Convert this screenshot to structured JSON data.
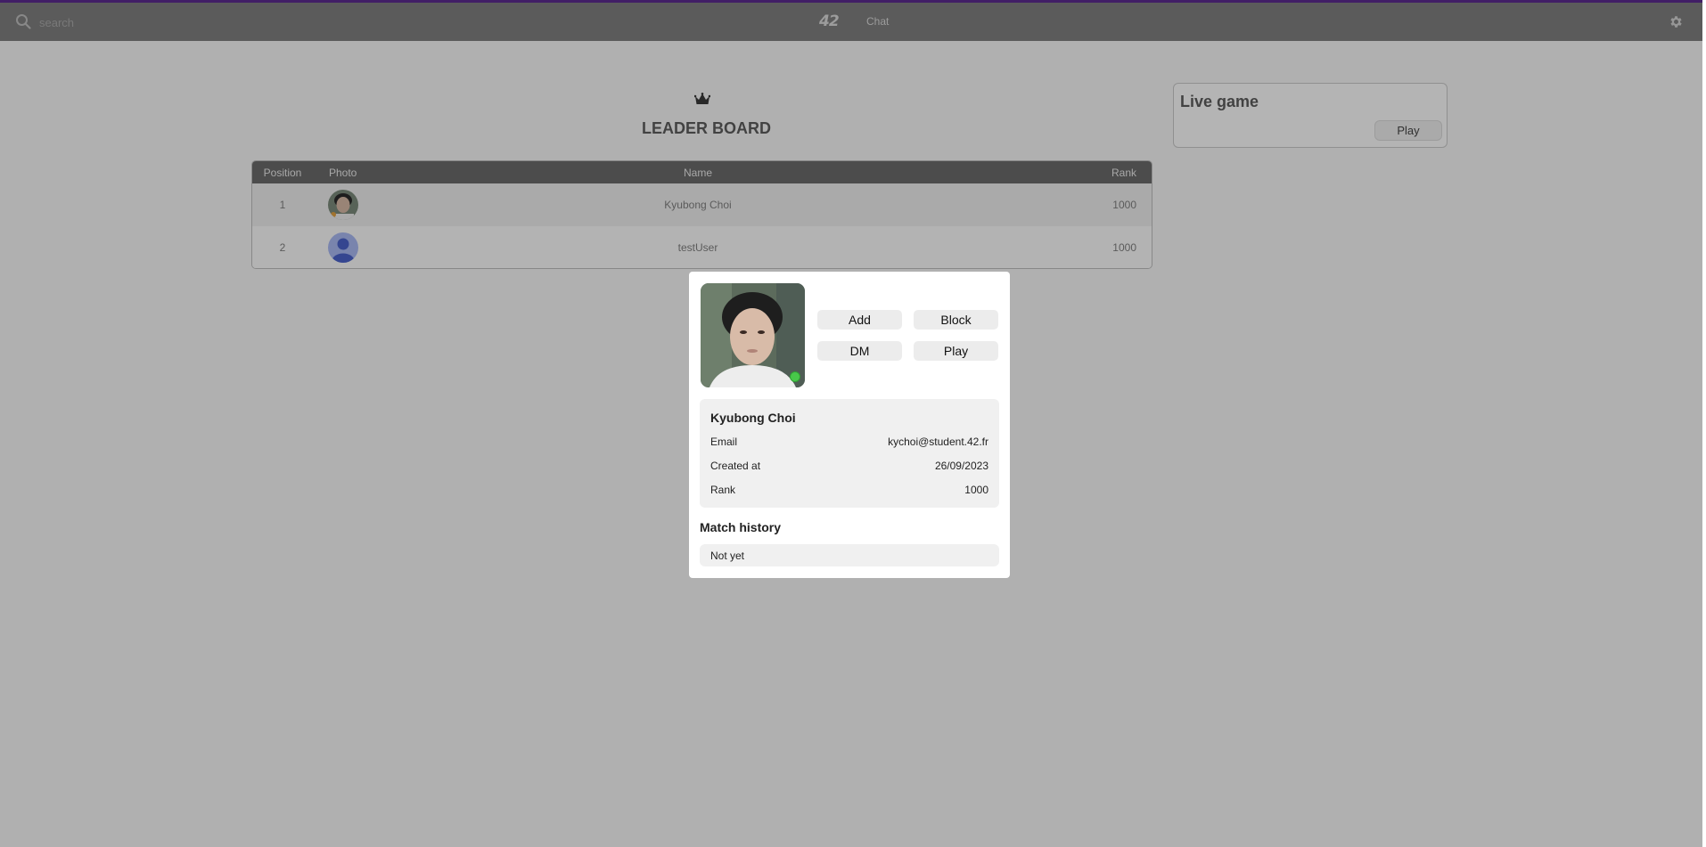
{
  "topbar": {
    "search_placeholder": "search",
    "logo": "42",
    "nav_chat": "Chat"
  },
  "leaderboard": {
    "title": "LEADER BOARD",
    "columns": [
      "Position",
      "Photo",
      "Name",
      "Rank"
    ],
    "rows": [
      {
        "position": "1",
        "name": "Kyubong Choi",
        "rank": "1000"
      },
      {
        "position": "2",
        "name": "testUser",
        "rank": "1000"
      }
    ]
  },
  "live_game": {
    "title": "Live game",
    "play_label": "Play"
  },
  "profile_modal": {
    "buttons": {
      "add": "Add",
      "block": "Block",
      "dm": "DM",
      "play": "Play"
    },
    "name": "Kyubong Choi",
    "fields": {
      "email_label": "Email",
      "email_value": "kychoi@student.42.fr",
      "created_label": "Created at",
      "created_value": "26/09/2023",
      "rank_label": "Rank",
      "rank_value": "1000"
    },
    "match_history_title": "Match history",
    "match_history_empty": "Not yet",
    "status": "online"
  },
  "colors": {
    "accent_top_line": "#5a2a8e",
    "online": "#48c84a",
    "topbar": "#7e7e7e"
  }
}
